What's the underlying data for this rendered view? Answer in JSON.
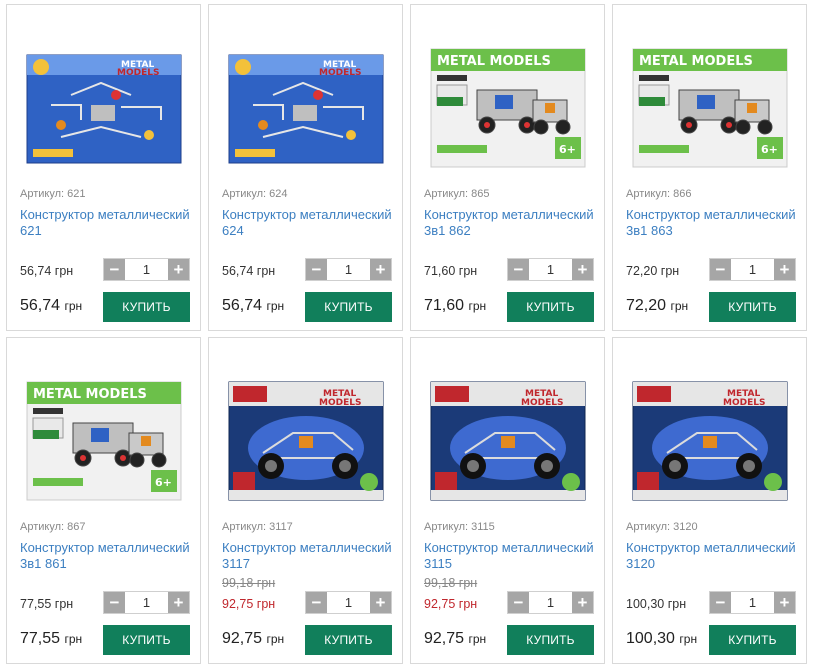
{
  "products": [
    {
      "article": "Артикул: 621",
      "name": "Конструктор металлический 621",
      "old_price": "",
      "price": "56,74 грн",
      "qty": "1",
      "total": "56,74",
      "currency": "грн",
      "buy_label": "КУПИТЬ",
      "box_style": "blue",
      "sale": false
    },
    {
      "article": "Артикул: 624",
      "name": "Конструктор металлический 624",
      "old_price": "",
      "price": "56,74 грн",
      "qty": "1",
      "total": "56,74",
      "currency": "грн",
      "buy_label": "КУПИТЬ",
      "box_style": "blue",
      "sale": false
    },
    {
      "article": "Артикул: 865",
      "name": "Конструктор металлический 3в1 862",
      "old_price": "",
      "price": "71,60 грн",
      "qty": "1",
      "total": "71,60",
      "currency": "грн",
      "buy_label": "КУПИТЬ",
      "box_style": "green",
      "sale": false
    },
    {
      "article": "Артикул: 866",
      "name": "Конструктор металлический 3в1 863",
      "old_price": "",
      "price": "72,20 грн",
      "qty": "1",
      "total": "72,20",
      "currency": "грн",
      "buy_label": "КУПИТЬ",
      "box_style": "green",
      "sale": false
    },
    {
      "article": "Артикул: 867",
      "name": "Конструктор металлический 3в1 861",
      "old_price": "",
      "price": "77,55 грн",
      "qty": "1",
      "total": "77,55",
      "currency": "грн",
      "buy_label": "КУПИТЬ",
      "box_style": "green",
      "sale": false
    },
    {
      "article": "Артикул: 3117",
      "name": "Конструктор металлический 3117",
      "old_price": "99,18 грн",
      "price": "92,75 грн",
      "qty": "1",
      "total": "92,75",
      "currency": "грн",
      "buy_label": "КУПИТЬ",
      "box_style": "darkblue",
      "sale": true
    },
    {
      "article": "Артикул: 3115",
      "name": "Конструктор металлический 3115",
      "old_price": "99,18 грн",
      "price": "92,75 грн",
      "qty": "1",
      "total": "92,75",
      "currency": "грн",
      "buy_label": "КУПИТЬ",
      "box_style": "darkblue",
      "sale": true
    },
    {
      "article": "Артикул: 3120",
      "name": "Конструктор металлический 3120",
      "old_price": "",
      "price": "100,30 грн",
      "qty": "1",
      "total": "100,30",
      "currency": "грн",
      "buy_label": "КУПИТЬ",
      "box_style": "darkblue",
      "sale": false
    }
  ],
  "box_texts": {
    "blue": "METAL MODELS",
    "green": "METAL MODELS",
    "darkblue": "METAL MODELS"
  },
  "colors": {
    "buy": "#117f5b",
    "link": "#3c7fc1",
    "sale": "#c0272d",
    "qty_button": "#a6a6a6"
  },
  "icons": {
    "minus": "minus-icon",
    "plus": "plus-icon"
  }
}
